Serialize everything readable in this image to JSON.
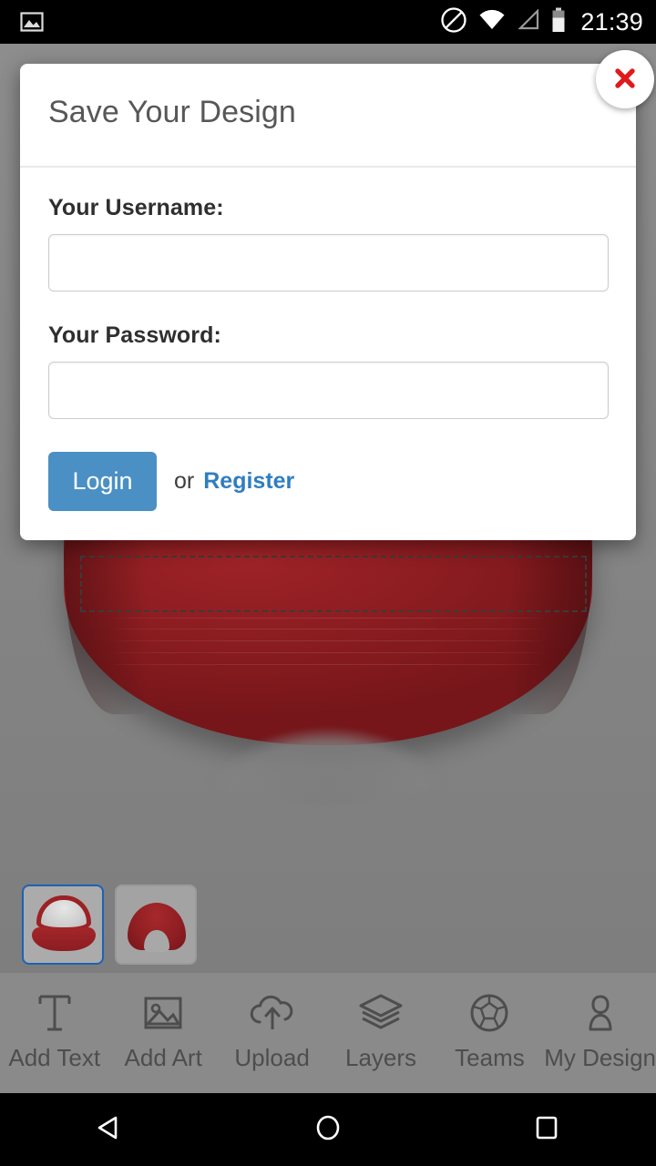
{
  "status_bar": {
    "time": "21:39",
    "icons": [
      "image-icon",
      "do-not-disturb-icon",
      "wifi-icon",
      "signal-icon",
      "battery-icon"
    ]
  },
  "modal": {
    "title": "Save Your Design",
    "close_icon": "close-x-icon",
    "username": {
      "label": "Your Username:",
      "value": "",
      "placeholder": ""
    },
    "password": {
      "label": "Your Password:",
      "value": "",
      "placeholder": ""
    },
    "login_label": "Login",
    "or_text": "or",
    "register_label": "Register",
    "colors": {
      "login_button": "#4a90c4",
      "register_link": "#2f7ec0",
      "close_x": "#e01b1b",
      "title": "#575757"
    }
  },
  "canvas": {
    "product_color": "#8d1d21",
    "background": "#858585",
    "selection_active": true
  },
  "thumbnails": [
    {
      "name": "cap-front-view",
      "selected": true
    },
    {
      "name": "cap-back-view",
      "selected": false
    }
  ],
  "toolbar": {
    "items": [
      {
        "label": "Add Text",
        "icon": "text-icon"
      },
      {
        "label": "Add Art",
        "icon": "image-icon"
      },
      {
        "label": "Upload",
        "icon": "cloud-upload-icon"
      },
      {
        "label": "Layers",
        "icon": "layers-icon"
      },
      {
        "label": "Teams",
        "icon": "soccer-ball-icon"
      },
      {
        "label": "My Design",
        "icon": "person-icon"
      }
    ]
  },
  "nav_bar": {
    "back": "back-triangle-icon",
    "home": "home-circle-icon",
    "recents": "recents-square-icon"
  }
}
